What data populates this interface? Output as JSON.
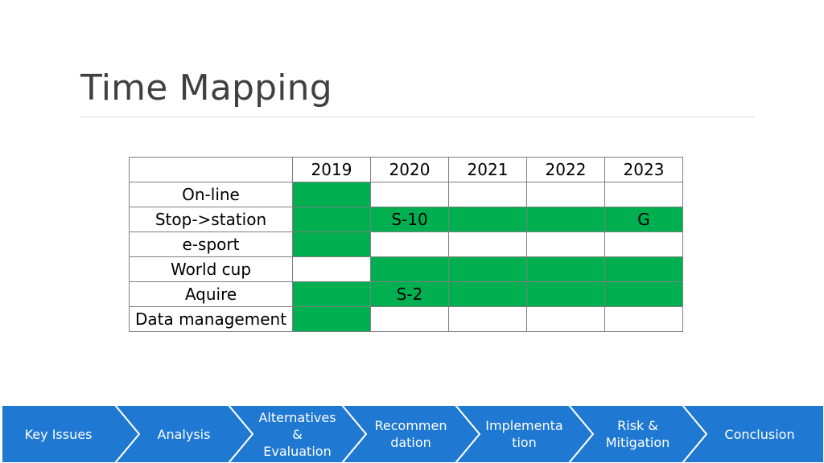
{
  "slide": {
    "title": "Time Mapping"
  },
  "table": {
    "years": [
      "2019",
      "2020",
      "2021",
      "2022",
      "2023"
    ],
    "rows": [
      {
        "label": "On-line",
        "cells": [
          {
            "on": true,
            "text": ""
          },
          {
            "on": false,
            "text": ""
          },
          {
            "on": false,
            "text": ""
          },
          {
            "on": false,
            "text": ""
          },
          {
            "on": false,
            "text": ""
          }
        ]
      },
      {
        "label": "Stop->station",
        "cells": [
          {
            "on": true,
            "text": ""
          },
          {
            "on": true,
            "text": "S-10"
          },
          {
            "on": true,
            "text": ""
          },
          {
            "on": true,
            "text": ""
          },
          {
            "on": true,
            "text": "G"
          }
        ]
      },
      {
        "label": "e-sport",
        "cells": [
          {
            "on": true,
            "text": ""
          },
          {
            "on": false,
            "text": ""
          },
          {
            "on": false,
            "text": ""
          },
          {
            "on": false,
            "text": ""
          },
          {
            "on": false,
            "text": ""
          }
        ]
      },
      {
        "label": "World cup",
        "cells": [
          {
            "on": false,
            "text": ""
          },
          {
            "on": true,
            "text": ""
          },
          {
            "on": true,
            "text": ""
          },
          {
            "on": true,
            "text": ""
          },
          {
            "on": true,
            "text": ""
          }
        ]
      },
      {
        "label": "Aquire",
        "cells": [
          {
            "on": true,
            "text": ""
          },
          {
            "on": true,
            "text": "S-2"
          },
          {
            "on": true,
            "text": ""
          },
          {
            "on": true,
            "text": ""
          },
          {
            "on": true,
            "text": ""
          }
        ]
      },
      {
        "label": "Data management",
        "cells": [
          {
            "on": true,
            "text": ""
          },
          {
            "on": false,
            "text": ""
          },
          {
            "on": false,
            "text": ""
          },
          {
            "on": false,
            "text": ""
          },
          {
            "on": false,
            "text": ""
          }
        ]
      }
    ],
    "colors": {
      "active": "#00b050",
      "border": "#7f7f7f"
    }
  },
  "process_bar": {
    "color": "#1f78d1",
    "steps": [
      "Key Issues",
      "Analysis",
      "Alternatives\n&\nEvaluation",
      "Recommen\ndation",
      "Implementa\ntion",
      "Risk &\nMitigation",
      "Conclusion"
    ]
  }
}
